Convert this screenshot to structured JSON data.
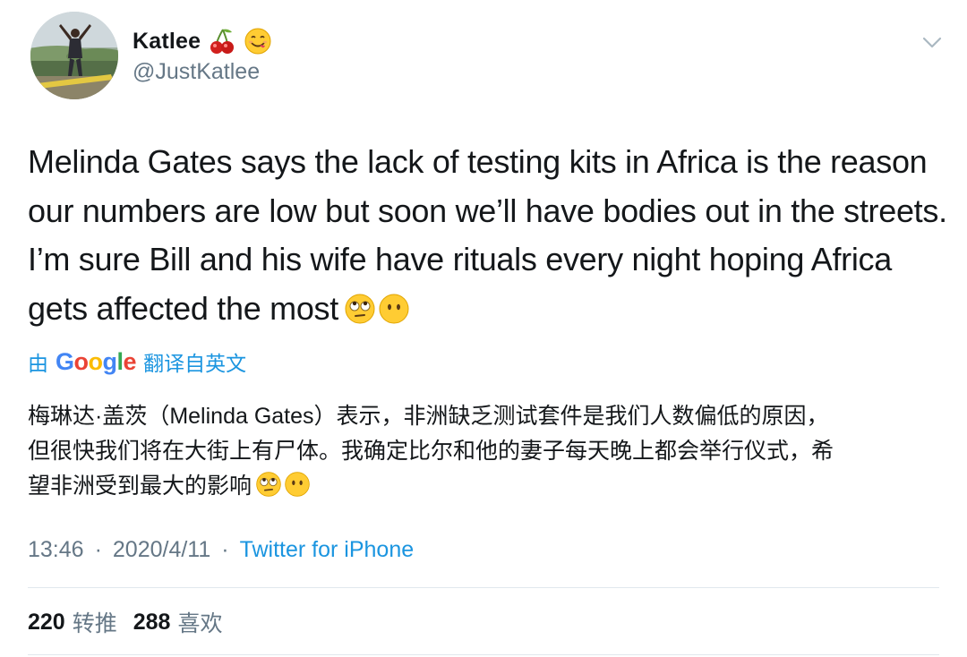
{
  "author": {
    "display_name": "Katlee",
    "name_emojis": [
      "cherries-emoji",
      "smiling-face-savoring-food-emoji"
    ],
    "handle": "@JustKatlee"
  },
  "tweet": {
    "text_lines": [
      "Melinda Gates says the lack of testing kits in Africa is the reason",
      "our numbers are low but soon we’ll have bodies out in the streets.",
      "I’m sure Bill and his wife have rituals every night hoping Africa",
      "gets affected the most"
    ],
    "trailing_emojis": [
      "face-with-rolling-eyes-emoji",
      "face-without-mouth-emoji"
    ]
  },
  "translation": {
    "by_label": "由",
    "provider": "Google",
    "action_label": "翻译自英文",
    "text_lines": [
      "梅琳达·盖茨（Melinda Gates）表示，非洲缺乏测试套件是我们人数偏低的原因，",
      "但很快我们将在大街上有尸体。我确定比尔和他的妻子每天晚上都会举行仪式，希",
      "望非洲受到最大的影响"
    ]
  },
  "meta": {
    "time": "13:46",
    "separator": "·",
    "date": "2020/4/11",
    "source": "Twitter for iPhone"
  },
  "stats": {
    "retweets_count": "220",
    "retweets_label": "转推",
    "likes_count": "288",
    "likes_label": "喜欢"
  },
  "colors": {
    "text": "#14171a",
    "secondary": "#657786",
    "link": "#1b95e0",
    "divider": "#e1e8ed"
  }
}
